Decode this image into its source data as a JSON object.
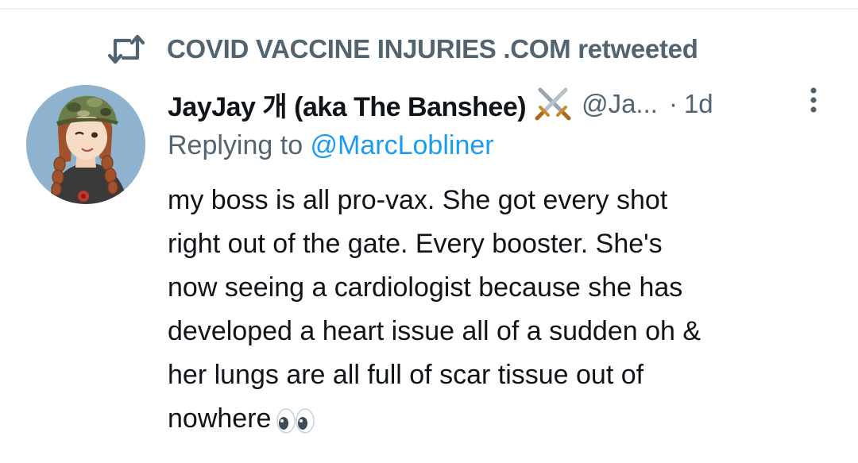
{
  "retweet": {
    "icon": "retweet-icon",
    "text": "COVID VACCINE INJURIES .COM retweeted"
  },
  "tweet": {
    "author": {
      "display_name": "JayJay 개 (aka The Banshee)",
      "badge_icon": "crossed-swords-icon",
      "handle": "@Ja...",
      "avatar_icon": "avatar-cartoon-girl"
    },
    "separator": "·",
    "time": "1d",
    "more_icon": "more-vertical-icon",
    "replying_prefix": "Replying to ",
    "replying_to": "@MarcLobliner",
    "body_lines": [
      "my boss is all pro-vax. She got every shot",
      "right out of the gate. Every booster. She's",
      "now seeing a cardiologist because she has",
      "developed a heart issue all of a sudden oh &",
      "her lungs are all full of scar tissue out of",
      "nowhere"
    ],
    "trailing_emoji": "eyes-emoji"
  },
  "colors": {
    "text_primary": "#0f1419",
    "text_secondary": "#536471",
    "link": "#1d9bf0",
    "divider": "#eff3f4"
  }
}
